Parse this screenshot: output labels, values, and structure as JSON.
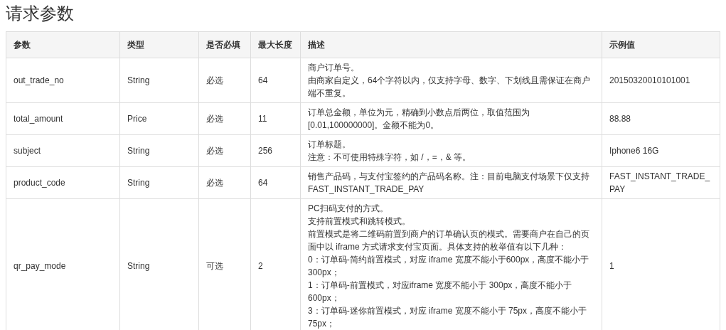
{
  "title": "请求参数",
  "table": {
    "columns": [
      "参数",
      "类型",
      "是否必填",
      "最大长度",
      "描述",
      "示例值"
    ],
    "rows": [
      {
        "param": "out_trade_no",
        "type": "String",
        "required": "必选",
        "max_length": "64",
        "description": [
          "商户订单号。",
          "由商家自定义，64个字符以内，仅支持字母、数字、下划线且需保证在商户端不重复。"
        ],
        "example": "2015032001010100​1"
      },
      {
        "param": "total_amount",
        "type": "Price",
        "required": "必选",
        "max_length": "11",
        "description": [
          "订单总金额，单位为元，精确到小数点后两位，取值范围为[0.01,100000000]。金额不能为0。"
        ],
        "example": "88.88"
      },
      {
        "param": "subject",
        "type": "String",
        "required": "必选",
        "max_length": "256",
        "description": [
          "订单标题。",
          "注意：不可使用特殊字符，如 /，=，& 等。"
        ],
        "example": "Iphone6 16G"
      },
      {
        "param": "product_code",
        "type": "String",
        "required": "必选",
        "max_length": "64",
        "description": [
          "销售产品码，与支付宝签约的产品码名称。注：目前电脑支付场景下仅支持FAST_INSTANT_TRADE_PAY"
        ],
        "example": "FAST_INSTANT_TRADE_PAY"
      },
      {
        "param": "qr_pay_mode",
        "type": "String",
        "required": "可选",
        "max_length": "2",
        "description": [
          "PC扫码支付的方式。",
          "支持前置模式和跳转模式。",
          "前置模式是将二维码前置到商户的订单确认页的模式。需要商户在自己的页面中以 iframe 方式请求支付宝页面。具体支持的枚举值有以下几种：",
          "0：订单码-简约前置模式，对应 iframe 宽度不能小于600px，高度不能小于300px；",
          "1：订单码-前置模式，对应iframe 宽度不能小于 300px，高度不能小于600px；",
          "3：订单码-迷你前置模式，对应 iframe 宽度不能小于 75px，高度不能小于75px；"
        ],
        "example": "1"
      }
    ]
  }
}
